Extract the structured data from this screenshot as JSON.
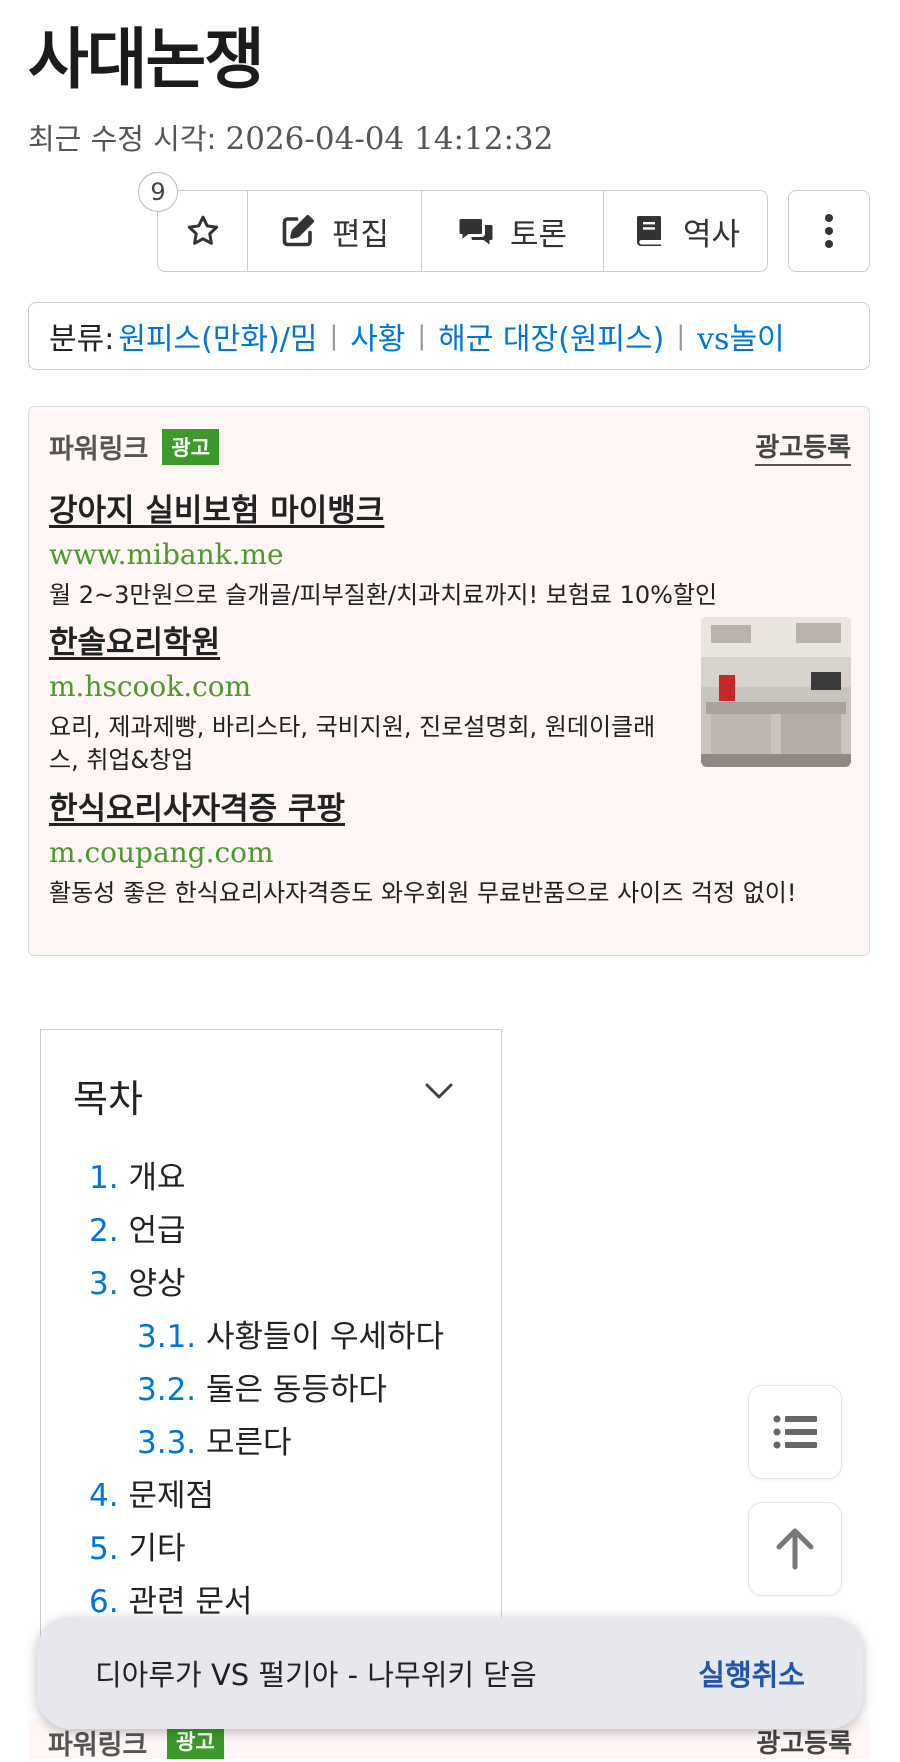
{
  "page": {
    "title": "사대논쟁",
    "modified_label": "최근 수정 시각:",
    "modified_time": "2026-04-04 14:12:32"
  },
  "toolbar": {
    "star_count": "9",
    "edit_label": "편집",
    "discuss_label": "토론",
    "history_label": "역사"
  },
  "category": {
    "label": "분류:",
    "items": [
      "원피스(만화)/밈",
      "사황",
      "해군 대장(원피스)",
      "vs놀이"
    ]
  },
  "ad": {
    "brand": "파워링크",
    "badge": "광고",
    "register": "광고등록",
    "items": [
      {
        "title": "강아지 실비보험 마이뱅크",
        "url": "www.mibank.me",
        "desc": "월 2~3만원으로 슬개골/피부질환/치과치료까지! 보험료 10%할인"
      },
      {
        "title": "한솔요리학원",
        "url": "m.hscook.com",
        "desc": "요리, 제과제빵, 바리스타, 국비지원, 진로설명회, 원데이클래스, 취업&창업"
      },
      {
        "title": "한식요리사자격증 쿠팡",
        "url": "m.coupang.com",
        "desc": "활동성 좋은 한식요리사자격증도 와우회원 무료반품으로 사이즈 걱정 없이!"
      }
    ]
  },
  "toc": {
    "title": "목차",
    "items": [
      {
        "num": "1.",
        "label": "개요"
      },
      {
        "num": "2.",
        "label": "언급"
      },
      {
        "num": "3.",
        "label": "양상"
      },
      {
        "num": "3.1.",
        "label": "사황들이 우세하다"
      },
      {
        "num": "3.2.",
        "label": "둘은 동등하다"
      },
      {
        "num": "3.3.",
        "label": "모른다"
      },
      {
        "num": "4.",
        "label": "문제점"
      },
      {
        "num": "5.",
        "label": "기타"
      },
      {
        "num": "6.",
        "label": "관련 문서"
      }
    ]
  },
  "toast": {
    "message": "디아루가 VS 펄기아 - 나무위키 닫음",
    "action": "실행취소"
  },
  "colors": {
    "link": "#0275d8",
    "ad_url": "#4c9a2e",
    "ad_badge": "#3c9a2a",
    "ad_background": "#fff6f6",
    "toast_action": "#2255a4"
  },
  "icons": [
    "star-icon",
    "edit-icon",
    "discussion-icon",
    "book-icon",
    "more-vertical-icon",
    "chevron-down-icon",
    "toc-list-icon",
    "arrow-up-icon"
  ]
}
